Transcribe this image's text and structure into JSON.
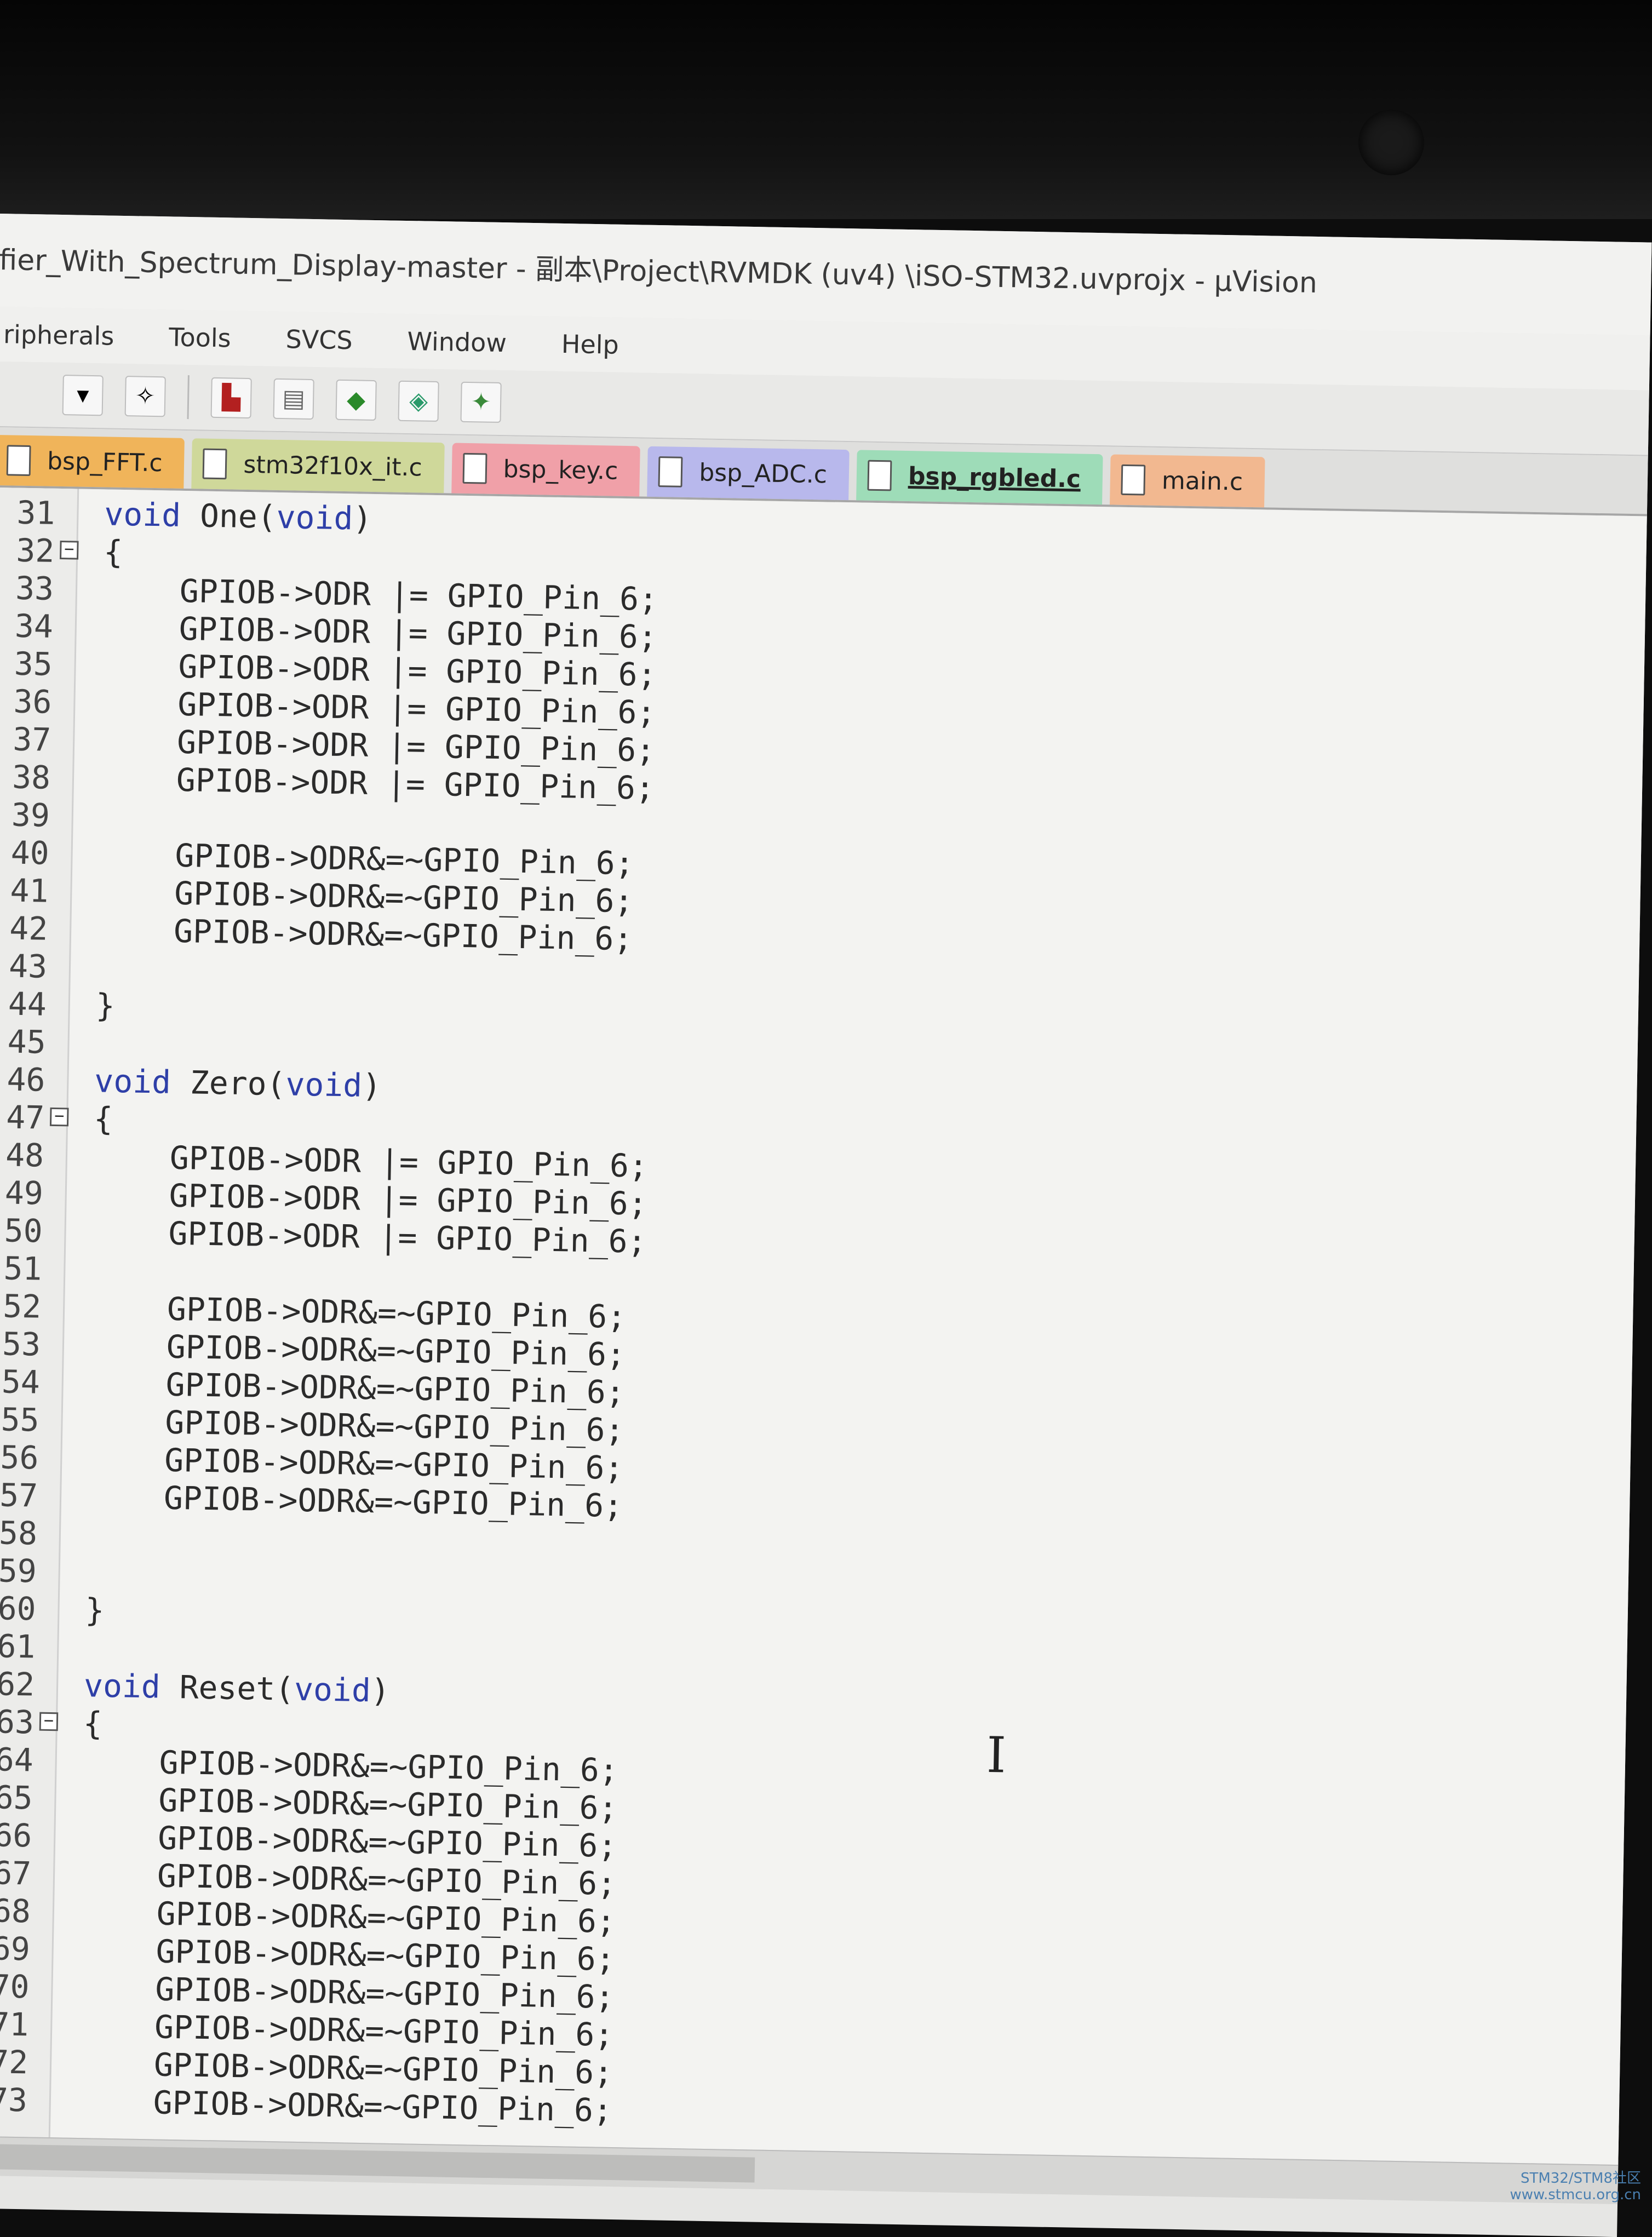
{
  "window": {
    "title": "fier_With_Spectrum_Display-master - 副本\\Project\\RVMDK (uv4) \\iSO-STM32.uvprojx - µVision"
  },
  "menu": [
    "ripherals",
    "Tools",
    "SVCS",
    "Window",
    "Help"
  ],
  "toolbar": {
    "icons": [
      "dropdown-icon",
      "magic-wand-icon",
      "build-icon",
      "batch-build-icon",
      "debug-diamond-icon",
      "start-debug-icon",
      "options-icon"
    ]
  },
  "tabs": [
    {
      "label": "bsp_FFT.c",
      "color": "#f0b45a",
      "active": false
    },
    {
      "label": "stm32f10x_it.c",
      "color": "#cfd89a",
      "active": false
    },
    {
      "label": "bsp_key.c",
      "color": "#f0a0a8",
      "active": false
    },
    {
      "label": "bsp_ADC.c",
      "color": "#b8b8ec",
      "active": false
    },
    {
      "label": "bsp_rgbled.c",
      "color": "#9edcb8",
      "active": true
    },
    {
      "label": "main.c",
      "color": "#f2b890",
      "active": false
    }
  ],
  "code": [
    {
      "num": "31",
      "text": "void One(void)",
      "indent": 0,
      "fold": false
    },
    {
      "num": "32",
      "text": "{",
      "indent": 0,
      "fold": true
    },
    {
      "num": "33",
      "text": "GPIOB->ODR |= GPIO_Pin_6;",
      "indent": 2,
      "fold": false
    },
    {
      "num": "34",
      "text": "GPIOB->ODR |= GPIO_Pin_6;",
      "indent": 2,
      "fold": false
    },
    {
      "num": "35",
      "text": "GPIOB->ODR |= GPIO_Pin_6;",
      "indent": 2,
      "fold": false
    },
    {
      "num": "36",
      "text": "GPIOB->ODR |= GPIO_Pin_6;",
      "indent": 2,
      "fold": false
    },
    {
      "num": "37",
      "text": "GPIOB->ODR |= GPIO_Pin_6;",
      "indent": 2,
      "fold": false
    },
    {
      "num": "38",
      "text": "GPIOB->ODR |= GPIO_Pin_6;",
      "indent": 2,
      "fold": false
    },
    {
      "num": "39",
      "text": "",
      "indent": 0,
      "fold": false
    },
    {
      "num": "40",
      "text": "GPIOB->ODR&=~GPIO_Pin_6;",
      "indent": 2,
      "fold": false
    },
    {
      "num": "41",
      "text": "GPIOB->ODR&=~GPIO_Pin_6;",
      "indent": 2,
      "fold": false
    },
    {
      "num": "42",
      "text": "GPIOB->ODR&=~GPIO_Pin_6;",
      "indent": 2,
      "fold": false
    },
    {
      "num": "43",
      "text": "",
      "indent": 0,
      "fold": false
    },
    {
      "num": "44",
      "text": "}",
      "indent": 0,
      "fold": false
    },
    {
      "num": "45",
      "text": "",
      "indent": 0,
      "fold": false
    },
    {
      "num": "46",
      "text": "void Zero(void)",
      "indent": 0,
      "fold": false
    },
    {
      "num": "47",
      "text": "{",
      "indent": 0,
      "fold": true
    },
    {
      "num": "48",
      "text": "GPIOB->ODR |= GPIO_Pin_6;",
      "indent": 2,
      "fold": false
    },
    {
      "num": "49",
      "text": "GPIOB->ODR |= GPIO_Pin_6;",
      "indent": 2,
      "fold": false
    },
    {
      "num": "50",
      "text": "GPIOB->ODR |= GPIO_Pin_6;",
      "indent": 2,
      "fold": false
    },
    {
      "num": "51",
      "text": "",
      "indent": 0,
      "fold": false
    },
    {
      "num": "52",
      "text": "GPIOB->ODR&=~GPIO_Pin_6;",
      "indent": 2,
      "fold": false
    },
    {
      "num": "53",
      "text": "GPIOB->ODR&=~GPIO_Pin_6;",
      "indent": 2,
      "fold": false
    },
    {
      "num": "54",
      "text": "GPIOB->ODR&=~GPIO_Pin_6;",
      "indent": 2,
      "fold": false
    },
    {
      "num": "55",
      "text": "GPIOB->ODR&=~GPIO_Pin_6;",
      "indent": 2,
      "fold": false
    },
    {
      "num": "56",
      "text": "GPIOB->ODR&=~GPIO_Pin_6;",
      "indent": 2,
      "fold": false
    },
    {
      "num": "57",
      "text": "GPIOB->ODR&=~GPIO_Pin_6;",
      "indent": 2,
      "fold": false
    },
    {
      "num": "58",
      "text": "",
      "indent": 0,
      "fold": false
    },
    {
      "num": "59",
      "text": "",
      "indent": 0,
      "fold": false
    },
    {
      "num": "60",
      "text": "}",
      "indent": 0,
      "fold": false
    },
    {
      "num": "61",
      "text": "",
      "indent": 0,
      "fold": false
    },
    {
      "num": "62",
      "text": "void Reset(void)",
      "indent": 0,
      "fold": false
    },
    {
      "num": "63",
      "text": "{",
      "indent": 0,
      "fold": true
    },
    {
      "num": "64",
      "text": "GPIOB->ODR&=~GPIO_Pin_6;",
      "indent": 2,
      "fold": false
    },
    {
      "num": "65",
      "text": "GPIOB->ODR&=~GPIO_Pin_6;",
      "indent": 2,
      "fold": false
    },
    {
      "num": "66",
      "text": "GPIOB->ODR&=~GPIO_Pin_6;",
      "indent": 2,
      "fold": false
    },
    {
      "num": "67",
      "text": "GPIOB->ODR&=~GPIO_Pin_6;",
      "indent": 2,
      "fold": false
    },
    {
      "num": "68",
      "text": "GPIOB->ODR&=~GPIO_Pin_6;",
      "indent": 2,
      "fold": false
    },
    {
      "num": "69",
      "text": "GPIOB->ODR&=~GPIO_Pin_6;",
      "indent": 2,
      "fold": false
    },
    {
      "num": "70",
      "text": "GPIOB->ODR&=~GPIO_Pin_6;",
      "indent": 2,
      "fold": false
    },
    {
      "num": "71",
      "text": "GPIOB->ODR&=~GPIO_Pin_6;",
      "indent": 2,
      "fold": false
    },
    {
      "num": "72",
      "text": "GPIOB->ODR&=~GPIO_Pin_6;",
      "indent": 2,
      "fold": false
    },
    {
      "num": "73",
      "text": "GPIOB->ODR&=~GPIO_Pin_6;",
      "indent": 2,
      "fold": false
    }
  ],
  "keywords": [
    "void"
  ],
  "watermark": "STM32/STM8社区\nwww.stmcu.org.cn"
}
